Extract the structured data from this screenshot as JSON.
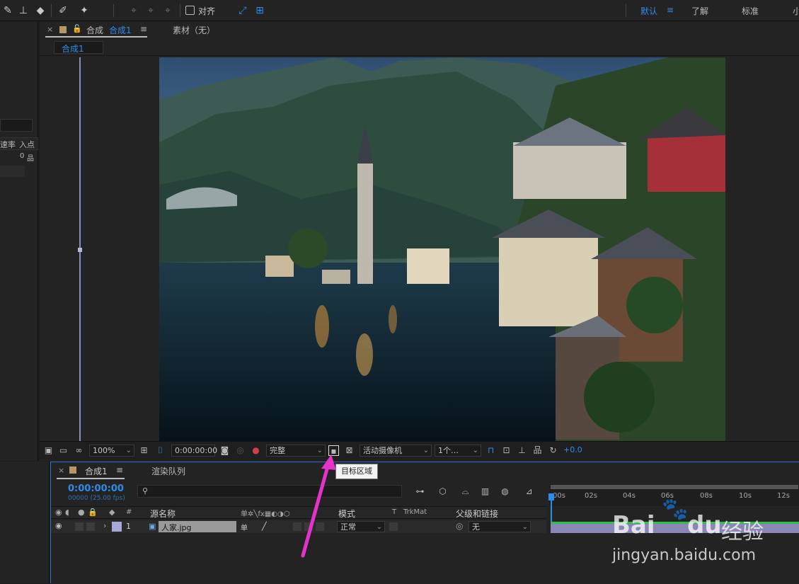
{
  "toolbar": {
    "tools": [
      "brush-icon",
      "stamp-icon",
      "eraser-icon",
      "roto-brush-icon",
      "puppet-pin-icon"
    ],
    "snap_label": "对齐",
    "workspaces": {
      "default": "默认",
      "default_menu": "≡",
      "learn": "了解",
      "standard": "标准",
      "small": "小"
    }
  },
  "viewer": {
    "tab_comp_prefix": "合成",
    "tab_comp_name": "合成1",
    "tab_menu": "≡",
    "tab_footage": "素材（无）",
    "subtab_comp": "合成1",
    "zoom": "100%",
    "timecode": "0:00:00:00",
    "resolution": "完整",
    "camera": "活动摄像机",
    "views": "1个…",
    "exposure": "+0.0",
    "accent": "#2d8ceb"
  },
  "left_panel": {
    "col_rate": "速率",
    "col_in": "入点",
    "value": "0"
  },
  "timeline": {
    "tab_comp": "合成1",
    "tab_menu": "≡",
    "tab_render": "渲染队列",
    "timecode": "0:00:00:00",
    "timecode_sub": "00000 (25.00 fps)",
    "search_placeholder": "",
    "headers": {
      "num": "#",
      "source_name": "源名称",
      "mode": "模式",
      "t": "T",
      "trkmat": "TrkMat",
      "parent": "父级和链接"
    },
    "ruler": [
      "00s",
      "02s",
      "04s",
      "06s",
      "08s",
      "10s",
      "12s"
    ],
    "layer": {
      "num": "1",
      "name": "人家.jpg",
      "mode": "正常",
      "parent": "无"
    }
  },
  "tooltip": {
    "text": "目标区域"
  },
  "watermark": {
    "brand_left": "Bai",
    "brand_right": "du",
    "brand_cn": "经验",
    "url": "jingyan.baidu.com"
  }
}
